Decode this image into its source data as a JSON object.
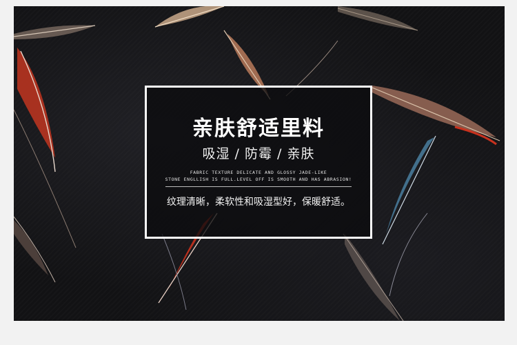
{
  "card": {
    "title": "亲肤舒适里料",
    "subtitle": "吸湿 / 防霉 / 亲肤",
    "english_line_1": "FABRIC TEXTURE DELICATE AND GLOSSY JADE-LIKE",
    "english_line_2": "STONE ENGLLISH IS FULL.LEVEL OFF IS SMOOTH AND HAS ABRASION!",
    "description": "纹理清晰，柔软性和吸湿型好，保暖舒适。"
  },
  "colors": {
    "page_background": "#f2f2f2",
    "fabric": "#121214",
    "card_border": "#ffffff",
    "feather_red": "#c8321e",
    "feather_blue": "#4a7fa0",
    "feather_tan": "#b89a80"
  }
}
